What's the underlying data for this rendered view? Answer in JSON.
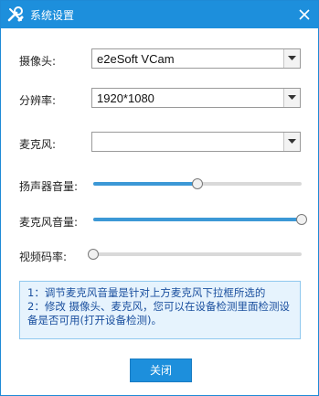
{
  "window": {
    "title": "系统设置"
  },
  "camera": {
    "label": "摄像头:",
    "value": "e2eSoft VCam"
  },
  "resolution": {
    "label": "分辨率:",
    "value": "1920*1080"
  },
  "microphone": {
    "label": "麦克风:",
    "value": ""
  },
  "speaker_volume": {
    "label": "扬声器音量:",
    "level": 0.5
  },
  "mic_volume": {
    "label": "麦克风音量:",
    "level": 1.0
  },
  "video_bitrate": {
    "label": "视频码率:",
    "level": 0.0
  },
  "note": {
    "line1": "1：调节麦克风音量是针对上方麦克风下拉框所选的",
    "line2": "2：修改 摄像头、麦克风，您可以在设备检测里面检测设备是否可用(",
    "link": "打开设备检测",
    "line2_end": ")。"
  },
  "close_button": {
    "label": "关闭"
  },
  "colors": {
    "accent": "#1d8fdc",
    "note_bg": "#e6f3fd",
    "note_text": "#1a4f9e"
  }
}
